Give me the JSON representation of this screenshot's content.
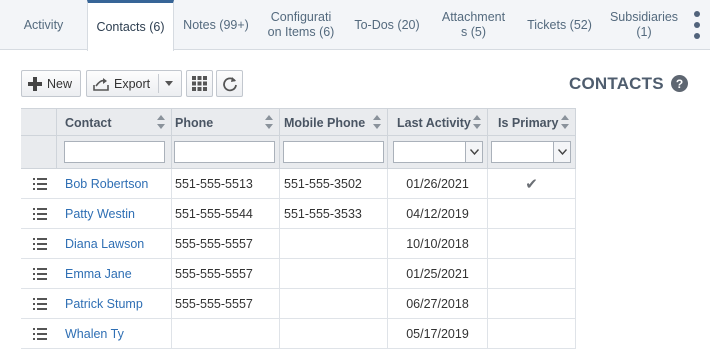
{
  "tabs": [
    {
      "label": "Activity",
      "active": false
    },
    {
      "label": "Contacts (6)",
      "active": true
    },
    {
      "label": "Notes (99+)",
      "active": false
    },
    {
      "label": "Configurati on Items (6)",
      "line1": "Configurati",
      "line2": "on Items (6)",
      "active": false
    },
    {
      "label": "To-Dos (20)",
      "active": false
    },
    {
      "label": "Attachment s (5)",
      "line1": "Attachment",
      "line2": "s (5)",
      "active": false
    },
    {
      "label": "Tickets (52)",
      "active": false
    },
    {
      "label": "Subsidiaries (1)",
      "line1": "Subsidiaries",
      "line2": "(1)",
      "active": false
    }
  ],
  "toolbar": {
    "new_label": "New",
    "export_label": "Export"
  },
  "section_title": "CONTACTS",
  "help_label": "?",
  "columns": [
    "Contact",
    "Phone",
    "Mobile Phone",
    "Last Activity",
    "Is Primary"
  ],
  "rows": [
    {
      "contact": "Bob Robertson",
      "phone": "551-555-5513",
      "mobile": "551-555-3502",
      "last_activity": "01/26/2021",
      "is_primary": true
    },
    {
      "contact": "Patty Westin",
      "phone": "551-555-5544",
      "mobile": "551-555-3533",
      "last_activity": "04/12/2019",
      "is_primary": false
    },
    {
      "contact": "Diana Lawson",
      "phone": "555-555-5557",
      "mobile": "",
      "last_activity": "10/10/2018",
      "is_primary": false
    },
    {
      "contact": "Emma Jane",
      "phone": "555-555-5557",
      "mobile": "",
      "last_activity": "01/25/2021",
      "is_primary": false
    },
    {
      "contact": "Patrick Stump",
      "phone": "555-555-5557",
      "mobile": "",
      "last_activity": "06/27/2018",
      "is_primary": false
    },
    {
      "contact": "Whalen Ty",
      "phone": "",
      "mobile": "",
      "last_activity": "05/17/2019",
      "is_primary": false
    }
  ],
  "check_glyph": "✔",
  "colors": {
    "link": "#2f6fb4",
    "tab_active_border": "#376597",
    "header_bg": "#e9ebee"
  }
}
